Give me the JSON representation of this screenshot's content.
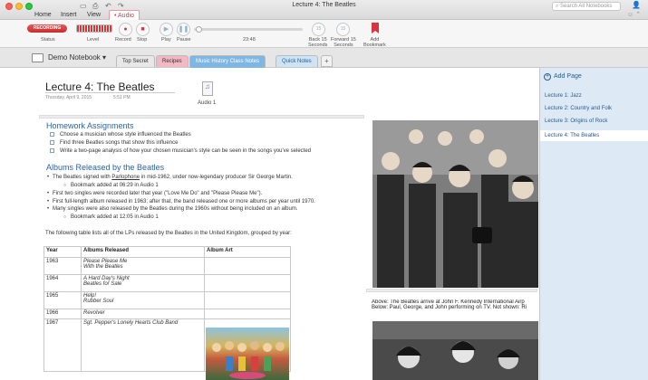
{
  "window": {
    "title": "Lecture 4: The Beatles",
    "search_placeholder": "Search All Notebooks"
  },
  "menu_tabs": [
    {
      "label": "Home"
    },
    {
      "label": "Insert"
    },
    {
      "label": "View"
    },
    {
      "label": "Audio"
    }
  ],
  "ribbon": {
    "recording_label": "RECORDING",
    "status_label": "Status",
    "level_label": "Level",
    "record_label": "Record",
    "stop_label": "Stop",
    "play_label": "Play",
    "pause_label": "Pause",
    "time": "23:48",
    "back_label": "Back 15\nSeconds",
    "forward_label": "Forward 15\nSeconds",
    "add_bookmark_label": "Add\nBookmark",
    "back_num": "15",
    "forward_num": "15",
    "record_color": "#d9343f"
  },
  "notebook": {
    "name": "Demo Notebook",
    "sections": [
      {
        "label": "Top Secret",
        "color": "#e8e8e8",
        "text_color": "#333"
      },
      {
        "label": "Recipes",
        "color": "#f4b8c2",
        "text_color": "#333"
      },
      {
        "label": "Music History Class Notes",
        "color": "#7fb7e4",
        "text_color": "#fff"
      },
      {
        "label": "Quick Notes",
        "color": "#cde4f6",
        "text_color": "#2a5a8c"
      }
    ]
  },
  "pages": {
    "add_label": "Add Page",
    "items": [
      {
        "label": "Lecture 1: Jazz"
      },
      {
        "label": "Lecture 2: Country and Folk"
      },
      {
        "label": "Lecture 3: Origins of Rock"
      },
      {
        "label": "Lecture 4: The Beatles"
      }
    ]
  },
  "page": {
    "title": "Lecture 4: The Beatles",
    "date": "Thursday, April 9, 2015",
    "time": "5:51 PM",
    "audio_label": "Audio 1",
    "homework_heading": "Homework Assignments",
    "todos": [
      "Choose a musician whose style influenced the Beatles",
      "Find three Beatles songs that show this influence",
      "Write a two-page analysis of how your chosen musician's style can be seen in the songs you've selected"
    ],
    "albums_heading": "Albums Released by the Beatles",
    "bullet1_pre": "The Beatles signed with ",
    "bullet1_link": "Parlophone",
    "bullet1_post": " in mid-1962, under now-legendary producer Sir George Martin.",
    "sub1": "Bookmark added at 06:29 in Audio 1",
    "bullet2": "First two singles were recorded later that year (\"Love Me Do\" and \"Please Please Me\").",
    "bullet3": "First full-length album released in 1963; after that, the band released one or more albums per year until 1970.",
    "bullet4": "Many singles were also released by the Beatles during the 1960s without being included on an album.",
    "sub2": "Bookmark added at 12:05 in Audio 1",
    "table_intro": "The following table lists all of the LPs released by the Beatles in the United Kingdom, grouped by year:",
    "table_headers": [
      "Year",
      "Albums Released",
      "Album Art"
    ],
    "table_rows": [
      {
        "year": "1963",
        "albums": "Please Please Me\nWith the Beatles"
      },
      {
        "year": "1964",
        "albums": "A Hard Day's Night\nBeatles for Sale"
      },
      {
        "year": "1965",
        "albums": "Help!\nRubber Soul"
      },
      {
        "year": "1966",
        "albums": "Revolver"
      },
      {
        "year": "1967",
        "albums": "Sgt. Pepper's Lonely Hearts Club Band"
      }
    ],
    "caption_line1": "Above: The Beatles arrive at John F. Kennedy International Airp",
    "caption_line2": "Below: Paul, George, and John performing on TV. Not shown: Ri"
  }
}
